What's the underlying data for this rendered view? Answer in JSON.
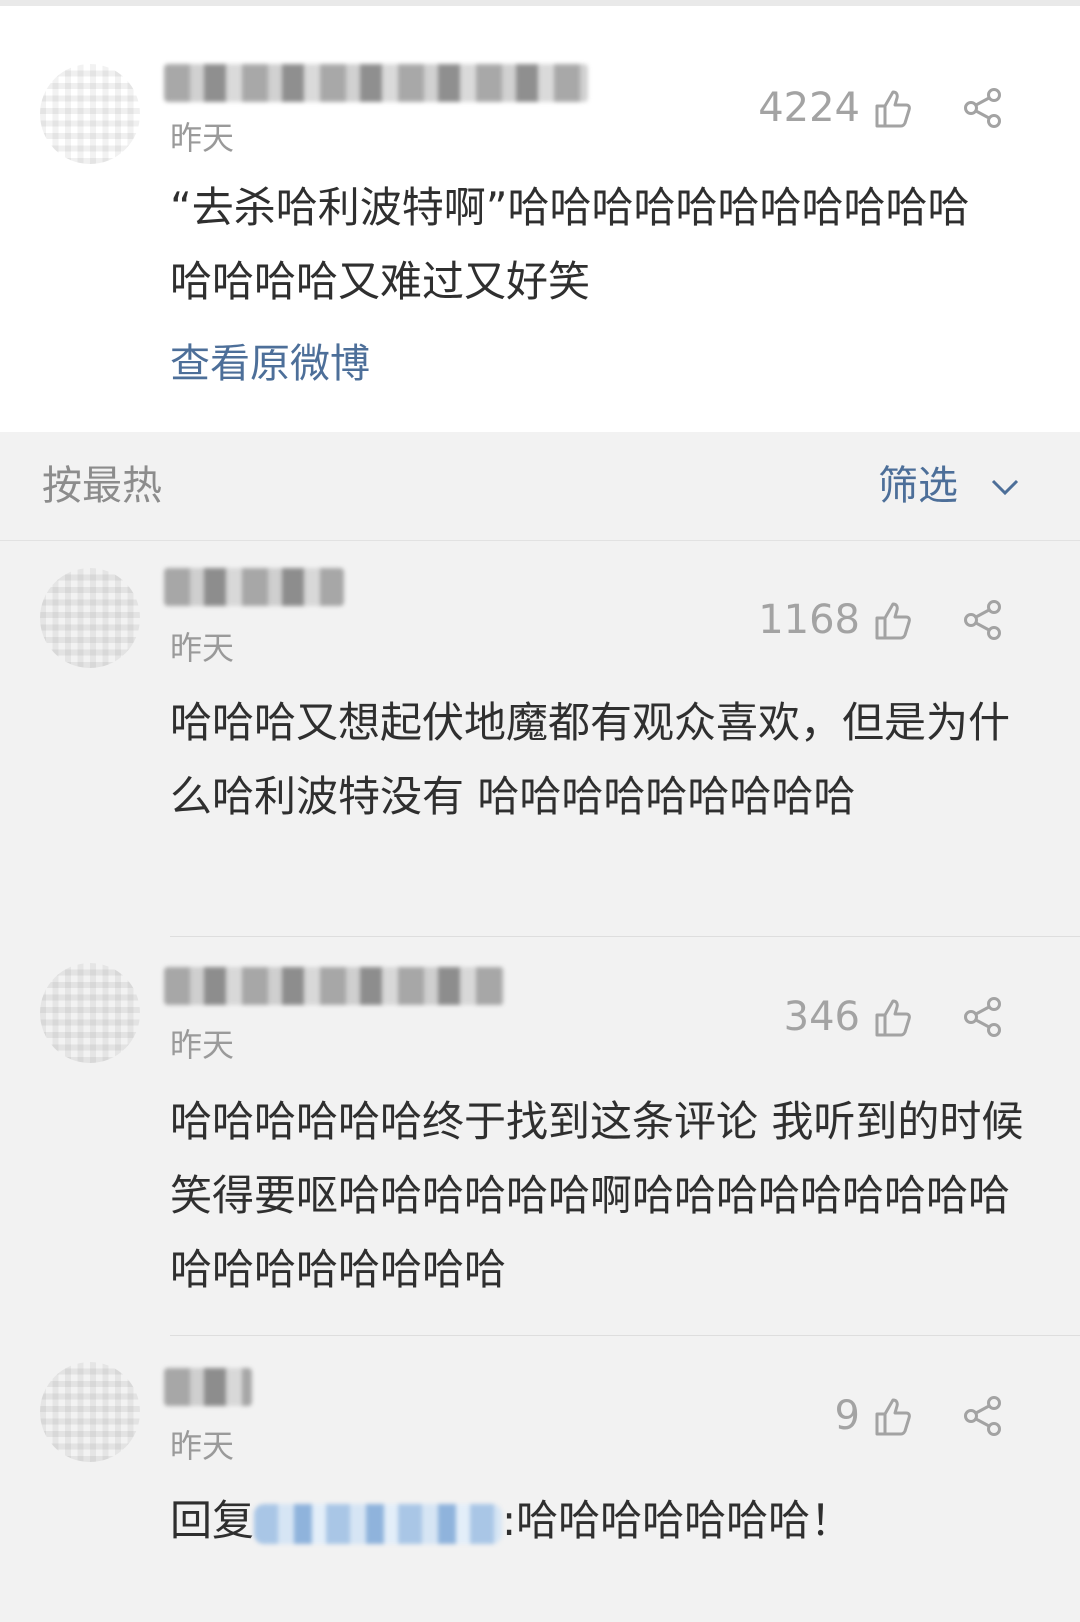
{
  "top_comment": {
    "time": "昨天",
    "likes": "4224",
    "text": "“去杀哈利波特啊”哈哈哈哈哈哈哈哈哈哈哈哈哈哈哈又难过又好笑",
    "view_original": "查看原微博"
  },
  "sort_bar": {
    "sort_label": "按最热",
    "filter_label": "筛选"
  },
  "comments": [
    {
      "time": "昨天",
      "likes": "1168",
      "text": "哈哈哈又想起伏地魔都有观众喜欢，但是为什么哈利波特没有 哈哈哈哈哈哈哈哈哈"
    },
    {
      "time": "昨天",
      "likes": "346",
      "text": "哈哈哈哈哈哈终于找到这条评论 我听到的时候笑得要呕哈哈哈哈哈哈啊哈哈哈哈哈哈哈哈哈哈哈哈哈哈哈哈哈"
    },
    {
      "time": "昨天",
      "likes": "9",
      "reply_prefix": "回复",
      "text": ":哈哈哈哈哈哈哈！"
    }
  ],
  "colors": {
    "link": "#4d6f99",
    "muted": "#a3a3a3",
    "background": "#f2f2f2"
  },
  "icons": [
    "thumbs-up-icon",
    "share-icon",
    "chevron-down-icon"
  ]
}
